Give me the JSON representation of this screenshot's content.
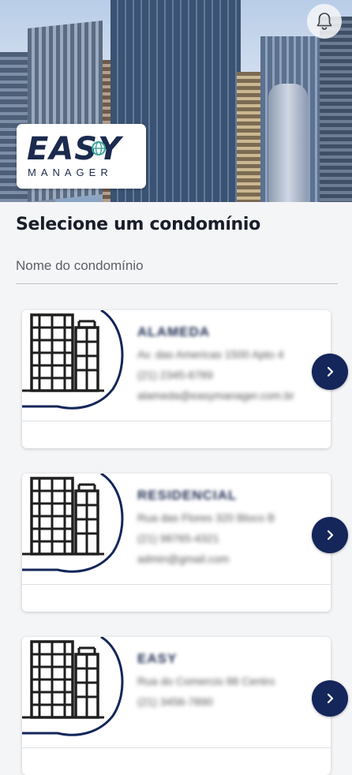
{
  "header": {
    "logo_word": "EASY",
    "logo_sub": "MANAGER",
    "notification_icon": "bell-icon"
  },
  "main": {
    "title": "Selecione um condomínio",
    "search": {
      "placeholder": "Nome do condomínio",
      "value": ""
    }
  },
  "condominiums": [
    {
      "name": "ALAMEDA",
      "address": "Av. das Americas 1500 Apto 4",
      "phone": "(21) 2345-6789",
      "email": "alameda@easymanager.com.br"
    },
    {
      "name": "RESIDENCIAL",
      "address": "Rua das Flores 320 Bloco B",
      "phone": "(21) 98765-4321",
      "email": "admin@gmail.com"
    },
    {
      "name": "EASY",
      "address": "Rua do Comercio 88 Centro",
      "phone": "(21) 3456-7890",
      "email": ""
    }
  ],
  "colors": {
    "brand_navy": "#14265a",
    "logo_navy": "#1b2a4e",
    "accent_teal": "#3aa39a",
    "background": "#f4f5f7"
  },
  "icons": {
    "arrow": "chevron-right-icon",
    "building": "building-icon"
  }
}
